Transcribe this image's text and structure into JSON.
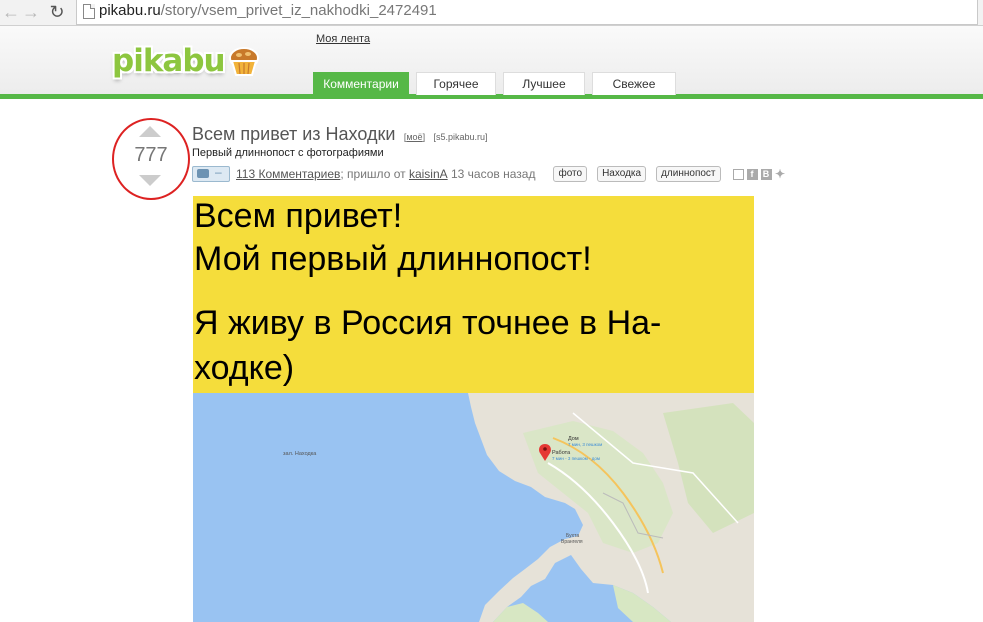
{
  "browser": {
    "url_host": "pikabu.ru",
    "url_path": "/story/vsem_privet_iz_nakhodki_2472491"
  },
  "header": {
    "logo_text": "pikabu",
    "my_feed": "Моя лента",
    "tabs": [
      {
        "label": "Комментарии",
        "active": true
      },
      {
        "label": "Горячее",
        "active": false
      },
      {
        "label": "Лучшее",
        "active": false
      },
      {
        "label": "Свежее",
        "active": false
      }
    ],
    "accent_color": "#56b847"
  },
  "story": {
    "rating": "777",
    "title": "Всем привет из Находки",
    "mine_tag": "моё",
    "source": "[s5.pikabu.ru]",
    "subtitle": "Первый длиннопост с фотографиями",
    "comments": "113 Комментариев",
    "posted_from": "; пришло от",
    "author": "kaisinA",
    "time_ago": "13 часов назад",
    "tags": [
      "фото",
      "Находка",
      "длиннопост"
    ],
    "share_icons": [
      "save-icon",
      "facebook-icon",
      "vk-icon",
      "twitter-icon"
    ]
  },
  "image": {
    "lines": [
      "Всем привет!",
      "Мой первый длиннопост!",
      "Я живу в Россия точнее в На-",
      "ходке)"
    ],
    "map_labels": {
      "bay": "зал. Находка",
      "home": "Дом",
      "home_sub": "7 мин, 3 пешком",
      "work": "Работа",
      "work_sub": "7 мин - 3 пешком - дом",
      "bay2": "Бухта",
      "bay2_sub": "Врангеля"
    }
  }
}
